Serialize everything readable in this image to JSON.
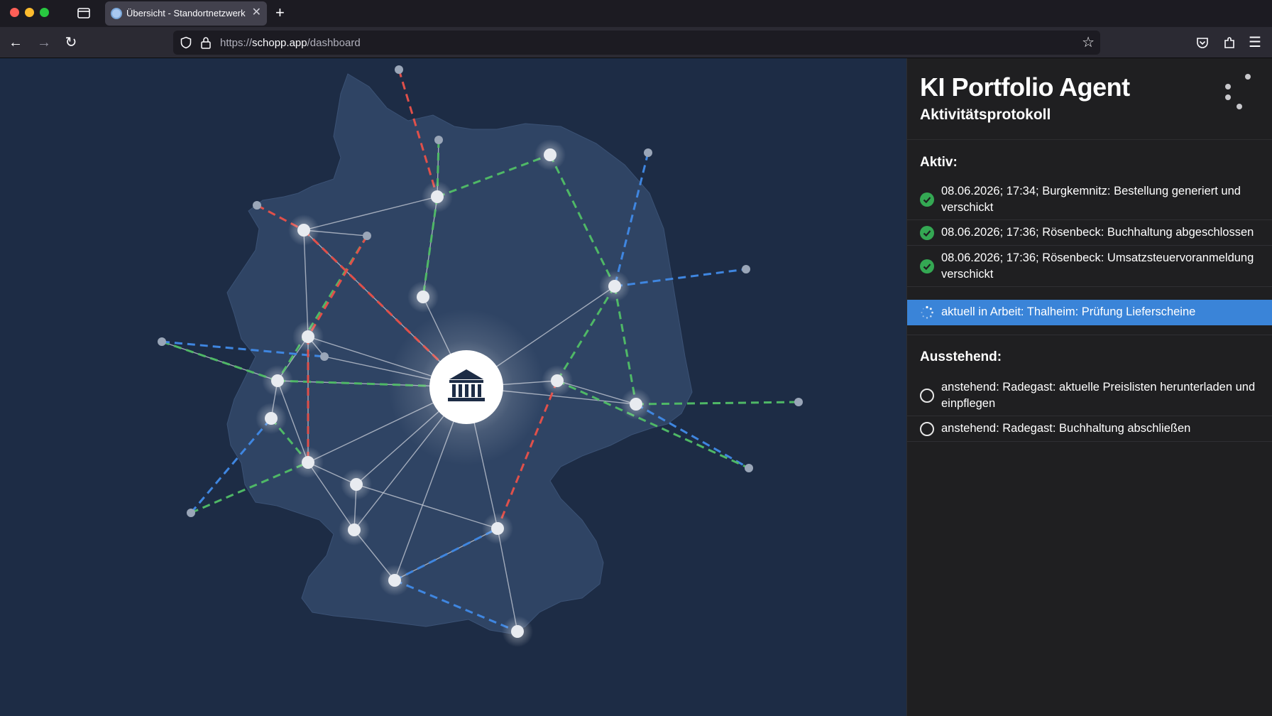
{
  "browser": {
    "tab_title": "Übersicht - Standortnetzwerk",
    "url_prefix": "https://",
    "url_host": "schopp.app",
    "url_path": "/dashboard"
  },
  "map": {
    "center_icon": "bank-icon",
    "colors": {
      "background": "#1d2c45",
      "land": "#2f4464",
      "link_white": "#c9ced8",
      "link_red": "#e0504a",
      "link_green": "#4fb866",
      "link_blue": "#3f86e0"
    }
  },
  "panel": {
    "title": "KI Portfolio Agent",
    "subtitle": "Aktivitätsprotokoll",
    "active_heading": "Aktiv:",
    "active_items": [
      {
        "status": "done",
        "text": "08.06.2026; 17:34; Burgkemnitz: Bestellung generiert und verschickt"
      },
      {
        "status": "done",
        "text": "08.06.2026; 17:36; Rösenbeck: Buchhaltung abgeschlossen"
      },
      {
        "status": "done",
        "text": "08.06.2026; 17:36; Rösenbeck: Umsatzsteuervoranmeldung verschickt"
      }
    ],
    "current_item": {
      "status": "in-progress",
      "text": "aktuell in Arbeit: Thalheim: Prüfung Lieferscheine"
    },
    "pending_heading": "Ausstehend:",
    "pending_items": [
      {
        "status": "pending",
        "text": "anstehend: Radegast: aktuelle Preislisten herunterladen und einpflegen"
      },
      {
        "status": "pending",
        "text": "anstehend: Radegast: Buchhaltung abschließen"
      }
    ],
    "colors": {
      "done": "#34a853",
      "current_bg": "#3a84d8"
    }
  }
}
